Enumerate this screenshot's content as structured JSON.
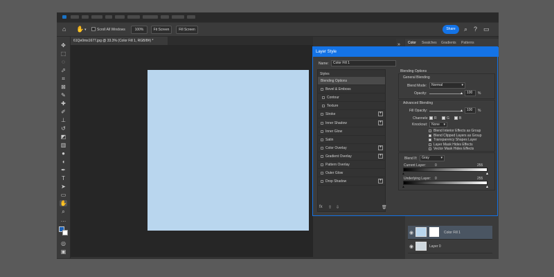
{
  "options_bar": {
    "scroll_all_windows": "Scroll All Windows",
    "zoom": "100%",
    "fit_screen": "Fit Screen",
    "fill_screen": "Fill Screen",
    "share": "Share"
  },
  "document": {
    "tab_title": "61Qe0ms1677.jpg @ 33.3% (Color Fill 1, RGB/8#) *",
    "fill_color": "#b9d6ee"
  },
  "panel_tabs": [
    "Color",
    "Swatches",
    "Gradients",
    "Patterns"
  ],
  "layer_style": {
    "title": "Layer Style",
    "name_label": "Name:",
    "name_value": "Color Fill 1",
    "styles_header": "Styles",
    "styles": [
      {
        "label": "Blending Options",
        "has_checkbox": false,
        "has_plus": false,
        "selected": true
      },
      {
        "label": "Bevel & Emboss",
        "has_checkbox": true,
        "has_plus": false
      },
      {
        "label": "Contour",
        "has_checkbox": true,
        "has_plus": false,
        "indent": true
      },
      {
        "label": "Texture",
        "has_checkbox": true,
        "has_plus": false,
        "indent": true
      },
      {
        "label": "Stroke",
        "has_checkbox": true,
        "has_plus": true
      },
      {
        "label": "Inner Shadow",
        "has_checkbox": true,
        "has_plus": true
      },
      {
        "label": "Inner Glow",
        "has_checkbox": true,
        "has_plus": false
      },
      {
        "label": "Satin",
        "has_checkbox": true,
        "has_plus": false
      },
      {
        "label": "Color Overlay",
        "has_checkbox": true,
        "has_plus": true
      },
      {
        "label": "Gradient Overlay",
        "has_checkbox": true,
        "has_plus": true
      },
      {
        "label": "Pattern Overlay",
        "has_checkbox": true,
        "has_plus": false
      },
      {
        "label": "Outer Glow",
        "has_checkbox": true,
        "has_plus": false
      },
      {
        "label": "Drop Shadow",
        "has_checkbox": true,
        "has_plus": true
      }
    ],
    "blending_options": {
      "header": "Blending Options",
      "general": "General Blending",
      "blend_mode_label": "Blend Mode:",
      "blend_mode": "Normal",
      "opacity_label": "Opacity:",
      "opacity": "100",
      "advanced": "Advanced Blending",
      "fill_opacity_label": "Fill Opacity:",
      "fill_opacity": "100",
      "percent": "%",
      "channels_label": "Channels:",
      "channels": [
        "R",
        "G",
        "B"
      ],
      "knockout_label": "Knockout:",
      "knockout": "None",
      "checks": [
        {
          "label": "Blend Interior Effects as Group",
          "checked": false
        },
        {
          "label": "Blend Clipped Layers as Group",
          "checked": true
        },
        {
          "label": "Transparency Shapes Layer",
          "checked": true
        },
        {
          "label": "Layer Mask Hides Effects",
          "checked": false
        },
        {
          "label": "Vector Mask Hides Effects",
          "checked": false
        }
      ],
      "blend_if_label": "Blend If:",
      "blend_if": "Gray",
      "current_layer": "Current Layer:",
      "underlying_layer": "Underlying Layer:",
      "range_min": "0",
      "range_max": "255"
    }
  },
  "layers": [
    {
      "name": "Color Fill 1",
      "selected": true
    },
    {
      "name": "Layer 0",
      "selected": false
    }
  ]
}
